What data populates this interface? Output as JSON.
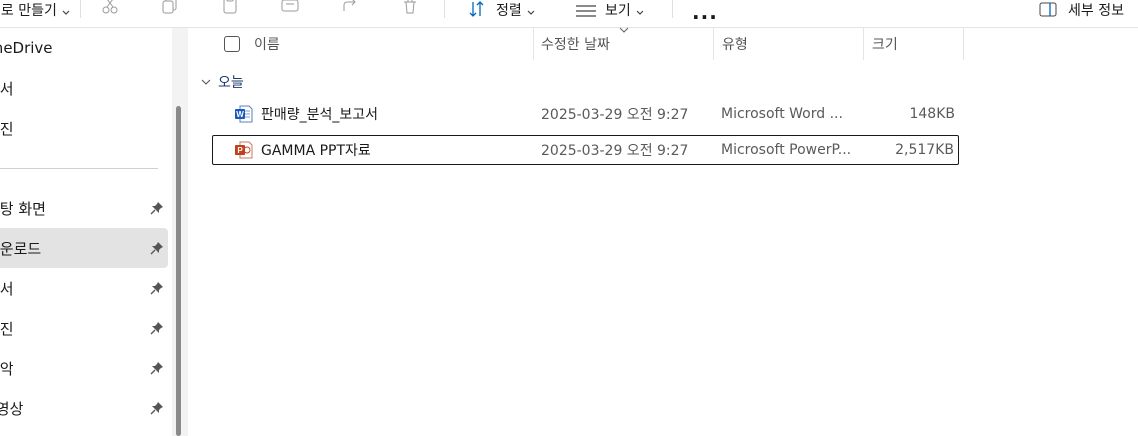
{
  "toolbar": {
    "new_label": "새로 만들기",
    "sort_label": "정렬",
    "view_label": "보기",
    "more_label": "...",
    "details_label": "세부 정보"
  },
  "sidebar": {
    "items": [
      {
        "label": "OneDrive",
        "pinned": false,
        "selected": false
      },
      {
        "label": "문서",
        "pinned": false,
        "selected": false
      },
      {
        "label": "사진",
        "pinned": false,
        "selected": false
      },
      {
        "label": "바탕 화면",
        "pinned": true,
        "selected": false
      },
      {
        "label": "다운로드",
        "pinned": true,
        "selected": true
      },
      {
        "label": "문서",
        "pinned": true,
        "selected": false
      },
      {
        "label": "사진",
        "pinned": true,
        "selected": false
      },
      {
        "label": "음악",
        "pinned": true,
        "selected": false
      },
      {
        "label": "동영상",
        "pinned": true,
        "selected": false
      }
    ]
  },
  "columns": {
    "name": "이름",
    "modified": "수정한 날짜",
    "type": "유형",
    "size": "크기"
  },
  "group": {
    "label": "오늘"
  },
  "files": [
    {
      "name": "판매량_분석_보고서",
      "modified": "2025-03-29 오전 9:27",
      "type": "Microsoft Word ...",
      "size": "148KB",
      "icon": "word-doc-icon"
    },
    {
      "name": "GAMMA PPT자료",
      "modified": "2025-03-29 오전 9:27",
      "type": "Microsoft PowerP...",
      "size": "2,517KB",
      "icon": "powerpoint-doc-icon"
    }
  ],
  "colors": {
    "accent": "#0067c0",
    "selected_bg": "#e3e3e3",
    "word_blue": "#185abd",
    "ppt_orange": "#c43e1c"
  }
}
